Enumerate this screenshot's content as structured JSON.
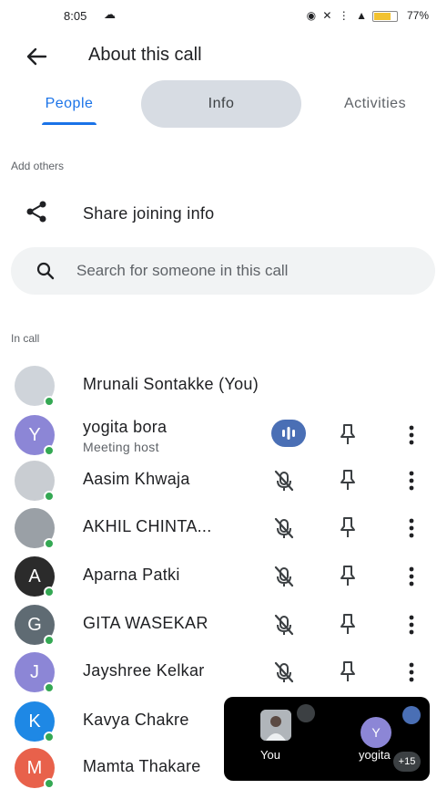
{
  "status_bar": {
    "time": "8:05",
    "alarm_icon": "cloud-icon",
    "icons_text": "◉ ✕ … ↑↓",
    "battery_percent": 77,
    "battery_label": "77%"
  },
  "header": {
    "title": "About this call",
    "back_icon": "arrow-back-icon"
  },
  "tabs": [
    {
      "label": "People",
      "selected": true
    },
    {
      "label": "Info",
      "selected": false
    },
    {
      "label": "Activities",
      "selected": false
    }
  ],
  "add_others": {
    "section_label": "Add others",
    "share_label": "Share joining info"
  },
  "search": {
    "placeholder": "Search for someone in this call"
  },
  "in_call": {
    "section_label": "In call",
    "participants": [
      {
        "name": "Mrunali Sontakke (You)",
        "avatar_initial": "",
        "avatar_color": "#cfd4da",
        "subtitle": "",
        "mic": "none"
      },
      {
        "name": "yogita bora",
        "avatar_initial": "Y",
        "avatar_color": "#8c86d6",
        "subtitle": "Meeting host",
        "mic": "speaking"
      },
      {
        "name": "Aasim Khwaja",
        "avatar_initial": "",
        "avatar_color": "#c9cdd2",
        "subtitle": "",
        "mic": "muted"
      },
      {
        "name": "AKHIL CHINTA...",
        "avatar_initial": "",
        "avatar_color": "#9aa0a6",
        "subtitle": "",
        "mic": "muted"
      },
      {
        "name": "Aparna Patki",
        "avatar_initial": "A",
        "avatar_color": "#2b2b2b",
        "subtitle": "",
        "mic": "muted"
      },
      {
        "name": "GITA WASEKAR",
        "avatar_initial": "G",
        "avatar_color": "#5f6b73",
        "subtitle": "",
        "mic": "muted"
      },
      {
        "name": "Jayshree Kelkar",
        "avatar_initial": "J",
        "avatar_color": "#8c86d6",
        "subtitle": "",
        "mic": "muted"
      },
      {
        "name": "Kavya Chakre",
        "avatar_initial": "K",
        "avatar_color": "#1e88e5",
        "subtitle": "",
        "mic": "none"
      },
      {
        "name": "Mamta Thakare",
        "avatar_initial": "M",
        "avatar_color": "#e8614b",
        "subtitle": "",
        "mic": "none"
      }
    ]
  },
  "floating_tiles": {
    "you_label": "You",
    "other_label": "yogita",
    "other_initial": "Y",
    "more_count": "+15"
  },
  "colors": {
    "accent": "#1a73e8",
    "online": "#34a853",
    "speaking": "#4a6fb5"
  }
}
